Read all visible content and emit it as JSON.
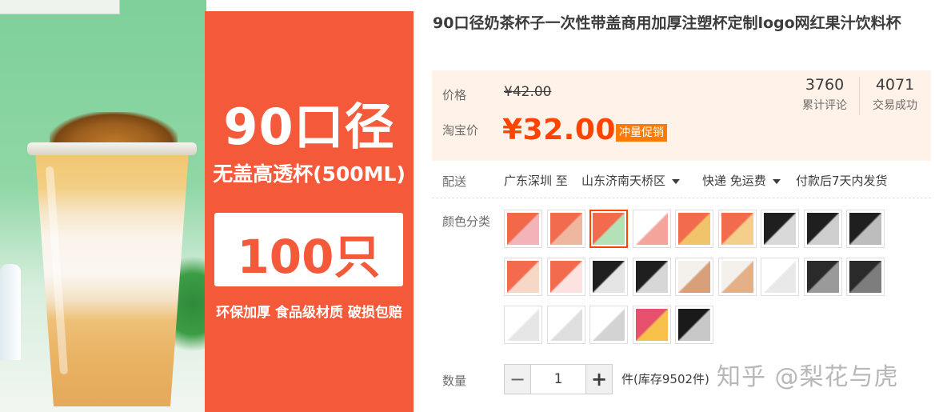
{
  "product": {
    "title": "90口径奶茶杯子一次性带盖商用加厚注塑杯定制logo网红果汁饮料杯"
  },
  "hero_image": {
    "size_line": "90口径",
    "sub_line": "无盖高透杯(500ML)",
    "count_line": "100只装",
    "footer_line": "环保加厚 食品级材质 破损包赔",
    "colors": {
      "panel": "#f45a3a",
      "background": "#8fd7a5"
    }
  },
  "price": {
    "orig_label": "价格",
    "orig_value": "¥42.00",
    "sale_label": "淘宝价",
    "sale_value": "¥32.00",
    "promo_tag": "冲量促销",
    "accent": "#ff4400"
  },
  "stats": {
    "reviews": {
      "value": "3760",
      "label": "累计评论"
    },
    "sales": {
      "value": "4071",
      "label": "交易成功"
    }
  },
  "shipping": {
    "label": "配送",
    "from": "广东深圳 至",
    "to": "山东济南天桥区",
    "method": "快递 免运费",
    "delivery": "付款后7天内发货"
  },
  "sku": {
    "label": "颜色分类",
    "selected_index": 2,
    "swatches": [
      {
        "name": "sku-1",
        "a": "#f06a4a",
        "b": "#f3b3b9"
      },
      {
        "name": "sku-2",
        "a": "#f26b4f",
        "b": "#f0b7a0"
      },
      {
        "name": "sku-3",
        "a": "#f26b4f",
        "b": "#b4e2b6"
      },
      {
        "name": "sku-4",
        "a": "#ffffff",
        "b": "#f3a49b"
      },
      {
        "name": "sku-5",
        "a": "#f26b4f",
        "b": "#f1c46b"
      },
      {
        "name": "sku-6",
        "a": "#f26b4f",
        "b": "#f3cf8a"
      },
      {
        "name": "sku-7",
        "a": "#1f1f1f",
        "b": "#d9d9d9"
      },
      {
        "name": "sku-8",
        "a": "#1f1f1f",
        "b": "#cfcfcf"
      },
      {
        "name": "sku-9",
        "a": "#1f1f1f",
        "b": "#bdbdbd"
      },
      {
        "name": "sku-10",
        "a": "#f26b4f",
        "b": "#f7d7c5"
      },
      {
        "name": "sku-11",
        "a": "#f26b4f",
        "b": "#fde2e2"
      },
      {
        "name": "sku-12",
        "a": "#1f1f1f",
        "b": "#e5e5e5"
      },
      {
        "name": "sku-13",
        "a": "#1f1f1f",
        "b": "#d7d7d7"
      },
      {
        "name": "sku-14",
        "a": "#f4f1ec",
        "b": "#d8a07a"
      },
      {
        "name": "sku-15",
        "a": "#f4f1ec",
        "b": "#e3b08a"
      },
      {
        "name": "sku-16",
        "a": "#ffffff",
        "b": "#e9e9e9"
      },
      {
        "name": "sku-17",
        "a": "#2a2a2a",
        "b": "#9a9a9a"
      },
      {
        "name": "sku-18",
        "a": "#2a2a2a",
        "b": "#7d7d7d"
      },
      {
        "name": "sku-19",
        "a": "#ffffff",
        "b": "#e6e6e6"
      },
      {
        "name": "sku-20",
        "a": "#ffffff",
        "b": "#dedede"
      },
      {
        "name": "sku-21",
        "a": "#ffffff",
        "b": "#d3d3d3"
      },
      {
        "name": "sku-22",
        "a": "#e8516e",
        "b": "#f6c04a"
      },
      {
        "name": "sku-23",
        "a": "#1a1a1a",
        "b": "#c8c8c8"
      }
    ]
  },
  "quantity": {
    "label": "数量",
    "value": "1",
    "minus": "−",
    "plus": "+",
    "stock": "件(库存9502件)"
  },
  "watermark": "知乎 @梨花与虎"
}
